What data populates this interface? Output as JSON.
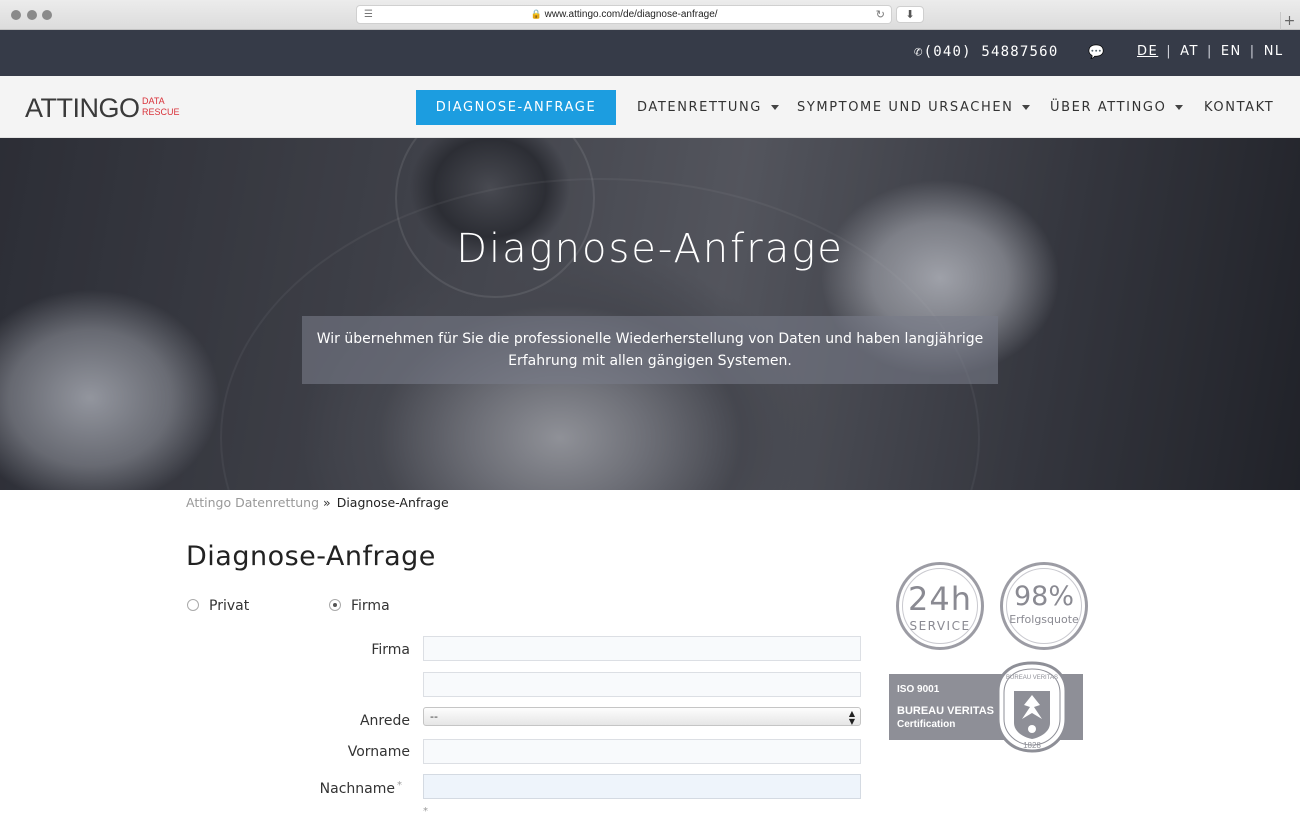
{
  "browser": {
    "url": "www.attingo.com/de/diagnose-anfrage/"
  },
  "topbar": {
    "phone": "(040) 54887560",
    "languages": [
      "DE",
      "AT",
      "EN",
      "NL"
    ],
    "active_language": "DE"
  },
  "nav": {
    "logo_main": "ATTINGO",
    "logo_sub": "DATA RESCUE",
    "cta": "DIAGNOSE-ANFRAGE",
    "items": [
      {
        "label": "DATENRETTUNG",
        "has_dropdown": true
      },
      {
        "label": "SYMPTOME UND URSACHEN",
        "has_dropdown": true
      },
      {
        "label": "ÜBER ATTINGO",
        "has_dropdown": true
      },
      {
        "label": "KONTAKT",
        "has_dropdown": false
      }
    ]
  },
  "hero": {
    "title": "Diagnose-Anfrage",
    "text_line1": "Wir übernehmen für Sie die professionelle Wiederherstellung von Daten und haben langjährige",
    "text_line2": "Erfahrung mit allen gängigen Systemen."
  },
  "breadcrumb": {
    "home": "Attingo Datenrettung",
    "separator": "»",
    "current": "Diagnose-Anfrage"
  },
  "form": {
    "title": "Diagnose-Anfrage",
    "radios": [
      {
        "label": "Privat",
        "checked": false
      },
      {
        "label": "Firma",
        "checked": true
      }
    ],
    "fields": {
      "firma_label": "Firma",
      "anrede_label": "Anrede",
      "anrede_value": "--",
      "vorname_label": "Vorname",
      "nachname_label": "Nachname",
      "required_mark": "*"
    }
  },
  "badges": {
    "service_big": "24h",
    "service_small": "SERVICE",
    "success_big": "98%",
    "success_small": "Erfolgsquote",
    "cert_iso": "ISO 9001",
    "cert_name": "BUREAU VERITAS",
    "cert_sub": "Certification",
    "seal_text": "BUREAU VERITAS",
    "seal_year": "1828"
  },
  "colors": {
    "topbar": "#363b48",
    "cta": "#1c9de0",
    "logo_accent": "#d9323a",
    "badge_gray": "#8e8f97"
  }
}
